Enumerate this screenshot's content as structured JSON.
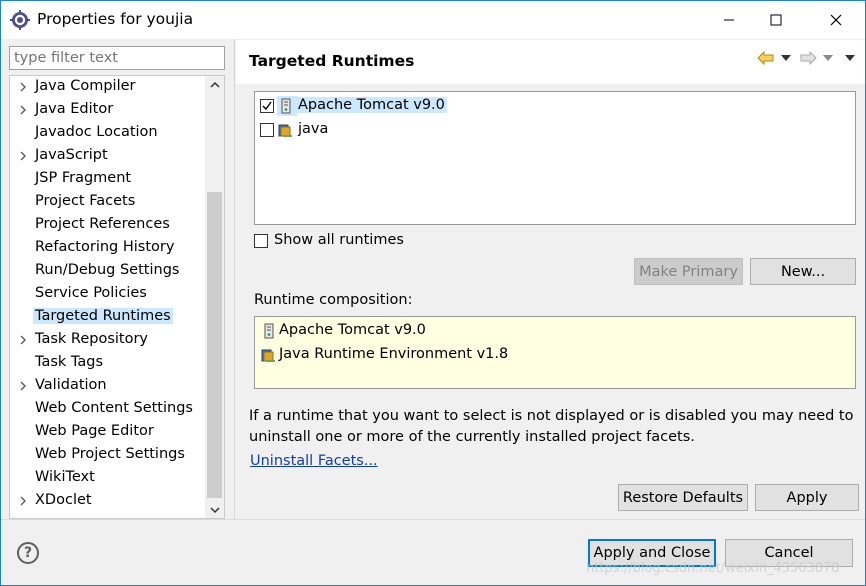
{
  "window": {
    "title": "Properties for youjia"
  },
  "filter": {
    "placeholder": "type filter text"
  },
  "tree": {
    "items": [
      {
        "label": "Java Compiler",
        "expandable": true
      },
      {
        "label": "Java Editor",
        "expandable": true
      },
      {
        "label": "Javadoc Location",
        "expandable": false
      },
      {
        "label": "JavaScript",
        "expandable": true
      },
      {
        "label": "JSP Fragment",
        "expandable": false
      },
      {
        "label": "Project Facets",
        "expandable": false
      },
      {
        "label": "Project References",
        "expandable": false
      },
      {
        "label": "Refactoring History",
        "expandable": false
      },
      {
        "label": "Run/Debug Settings",
        "expandable": false
      },
      {
        "label": "Service Policies",
        "expandable": false
      },
      {
        "label": "Targeted Runtimes",
        "expandable": false,
        "selected": true
      },
      {
        "label": "Task Repository",
        "expandable": true
      },
      {
        "label": "Task Tags",
        "expandable": false
      },
      {
        "label": "Validation",
        "expandable": true
      },
      {
        "label": "Web Content Settings",
        "expandable": false
      },
      {
        "label": "Web Page Editor",
        "expandable": false
      },
      {
        "label": "Web Project Settings",
        "expandable": false
      },
      {
        "label": "WikiText",
        "expandable": false
      },
      {
        "label": "XDoclet",
        "expandable": true
      }
    ]
  },
  "page": {
    "title": "Targeted Runtimes",
    "runtimes": [
      {
        "label": "Apache Tomcat v9.0",
        "checked": true,
        "icon": "tomcat-server-icon",
        "selected": true
      },
      {
        "label": "java",
        "checked": false,
        "icon": "java-runtime-icon"
      }
    ],
    "show_all_label": "Show all runtimes",
    "make_primary_label": "Make Primary",
    "new_label": "New...",
    "composition_label": "Runtime composition:",
    "composition": [
      {
        "label": "Apache Tomcat v9.0",
        "icon": "tomcat-server-icon"
      },
      {
        "label": "Java Runtime Environment v1.8",
        "icon": "java-runtime-icon"
      }
    ],
    "info_text": "If a runtime that you want to select is not displayed or is disabled you may need to uninstall one or more of the currently installed project facets.",
    "uninstall_link": "Uninstall Facets...",
    "restore_defaults_label": "Restore Defaults",
    "apply_label": "Apply"
  },
  "footer": {
    "help_icon": "?",
    "apply_close_label": "Apply and Close",
    "cancel_label": "Cancel"
  },
  "watermark": "https://blog.csdn.net/weixin_43563878",
  "colors": {
    "selection": "#cce8ff",
    "link": "#0f3fa7",
    "accent": "#0078d7",
    "composition_bg": "#ffffe1"
  }
}
